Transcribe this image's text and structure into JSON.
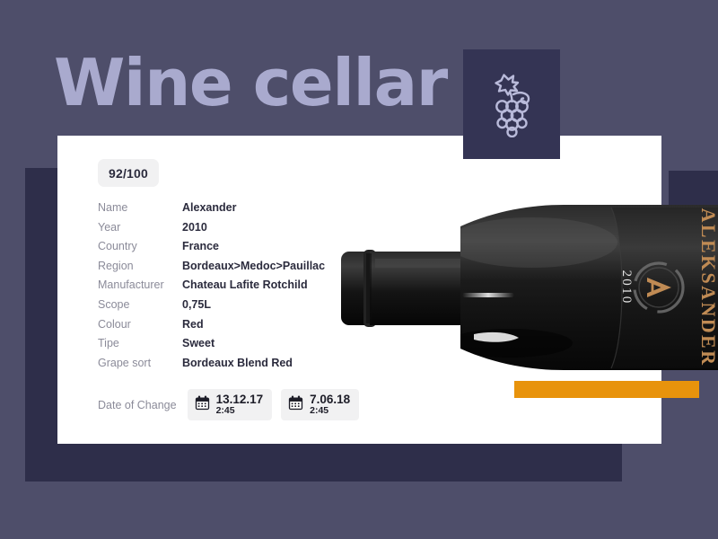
{
  "page": {
    "title": "Wine cellar",
    "background_color": "#4e4e6a",
    "accent_color": "#e8930c",
    "card_color": "#ffffff",
    "dark_slab_color": "#2e2e4a",
    "title_color": "#a9aace"
  },
  "brand_icon": {
    "name": "grape-icon",
    "tile_color": "#343454",
    "stroke_color": "#b9bada"
  },
  "score": {
    "value": "92/100"
  },
  "details": [
    {
      "label": "Name",
      "value": "Alexander"
    },
    {
      "label": "Year",
      "value": "2010"
    },
    {
      "label": "Country",
      "value": "France"
    },
    {
      "label": "Region",
      "value": "Bordeaux>Medoc>Pauillac"
    },
    {
      "label": "Manufacturer",
      "value": "Chateau Lafite Rotchild"
    },
    {
      "label": "Scope",
      "value": "0,75L"
    },
    {
      "label": "Colour",
      "value": "Red"
    },
    {
      "label": "Tipe",
      "value": "Sweet"
    },
    {
      "label": "Grape sort",
      "value": "Bordeaux Blend Red"
    }
  ],
  "date_of_change": {
    "label": "Date of Change",
    "entries": [
      {
        "icon": "calendar-icon",
        "date": "13.12.17",
        "time": "2:45"
      },
      {
        "icon": "calendar-icon",
        "date": "7.06.18",
        "time": "2:45"
      }
    ]
  },
  "bottle": {
    "name": "wine-bottle-photo",
    "label_brand": "ALEKSANDER",
    "label_year": "2010",
    "label_monogram": "A",
    "glass_color": "#141414",
    "label_gold": "#c08b54"
  }
}
